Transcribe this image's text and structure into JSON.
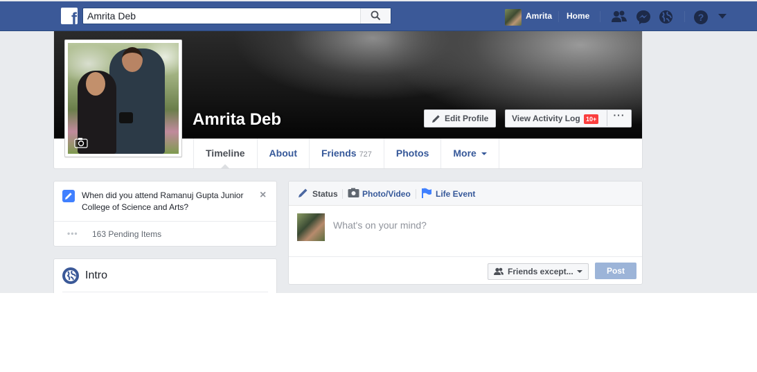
{
  "topbar": {
    "search_value": "Amrita Deb",
    "search_icon": "search-icon",
    "user_name": "Amrita",
    "home_label": "Home",
    "icons": [
      "friend-requests-icon",
      "messenger-icon",
      "notifications-globe-icon",
      "help-icon",
      "account-menu-caret-icon"
    ],
    "brand_color": "#3b5998"
  },
  "profile": {
    "name": "Amrita Deb",
    "edit_profile_label": "Edit Profile",
    "activity_log_label": "View Activity Log",
    "activity_badge": "10+",
    "more_label": "···",
    "tabs": [
      {
        "label": "Timeline",
        "count": ""
      },
      {
        "label": "About",
        "count": ""
      },
      {
        "label": "Friends",
        "count": "727"
      },
      {
        "label": "Photos",
        "count": ""
      },
      {
        "label": "More",
        "count": ""
      }
    ]
  },
  "question": {
    "text": "When did you attend Ramanuj Gupta Junior College of Science and Arts?",
    "close": "×",
    "dots": "•••",
    "pending": "163 Pending Items"
  },
  "intro": {
    "title": "Intro"
  },
  "composer": {
    "tabs": [
      {
        "label": "Status"
      },
      {
        "label": "Photo/Video"
      },
      {
        "label": "Life Event"
      }
    ],
    "placeholder": "What's on your mind?",
    "audience_label": "Friends except...",
    "post_label": "Post"
  }
}
